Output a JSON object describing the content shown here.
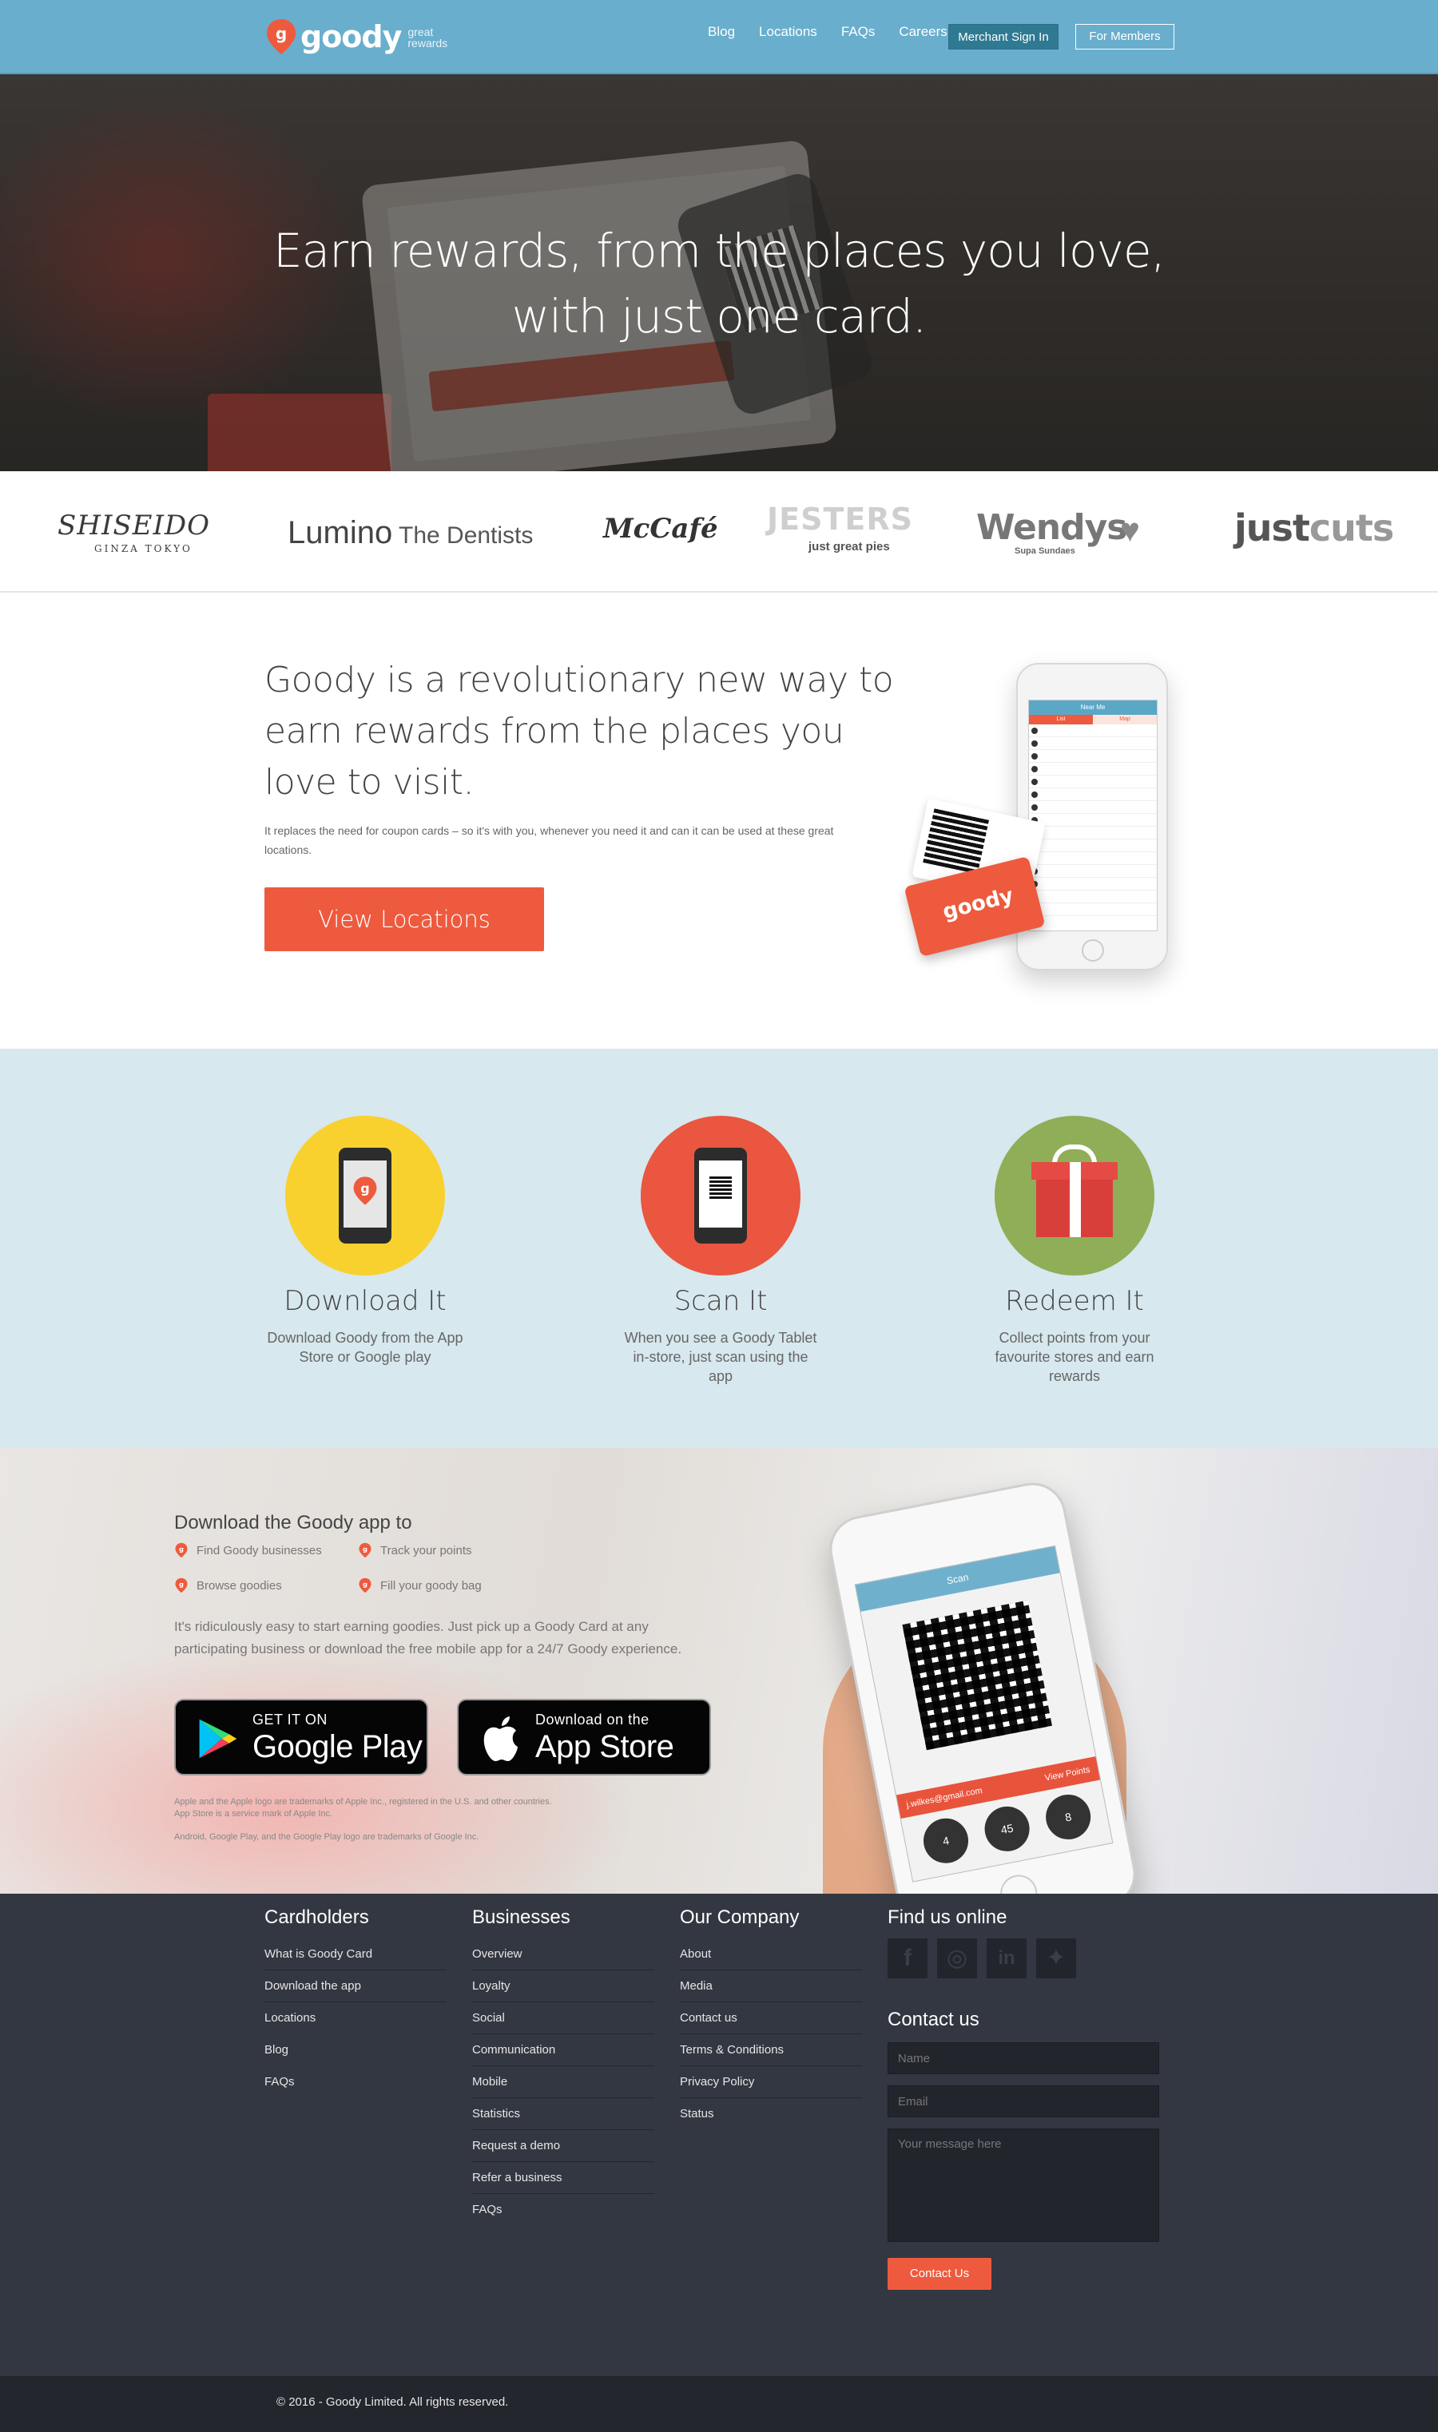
{
  "nav": {
    "logo_word": "goody",
    "logo_tagline_1": "great",
    "logo_tagline_2": "rewards",
    "links": [
      "Blog",
      "Locations",
      "FAQs",
      "Careers"
    ],
    "merchant_sign_in": "Merchant Sign In",
    "for_members": "For Members"
  },
  "hero": {
    "title_line1": "Earn rewards, from the places you love,",
    "title_line2": "with just one card."
  },
  "brands": {
    "shiseido": "SHISEIDO",
    "shiseido_sub": "GINZA TOKYO",
    "lumino": "Lumino",
    "lumino_sub": " The Dentists",
    "mccafe": "McCafé",
    "jesters": "JESTERS",
    "jesters_sub": "just great pies",
    "wendys": "Wendys",
    "wendys_sub": "Supa Sundaes",
    "justcuts_a": "just",
    "justcuts_b": "cuts"
  },
  "intro": {
    "title": "Goody is a revolutionary new way to earn rewards from the places you love to visit.",
    "text": "It replaces the need for coupon cards – so it's with you, whenever you need it and can it can be used at these great locations.",
    "button": "View Locations",
    "phone_header": "Near Me",
    "phone_tab_a": "List",
    "phone_tab_b": "Map",
    "card_word": "goody"
  },
  "steps": [
    {
      "title": "Download It",
      "desc": "Download Goody from the App Store or Google play",
      "color": "#f8d12f"
    },
    {
      "title": "Scan It",
      "desc": "When you see a Goody Tablet in-store, just scan using the app",
      "color": "#ea5640"
    },
    {
      "title": "Redeem It",
      "desc": "Collect points from your favourite stores and earn rewards",
      "color": "#8fae57"
    }
  ],
  "app": {
    "heading": "Download the Goody app to",
    "features": [
      "Find Goody businesses",
      "Track your points",
      "Browse goodies",
      "Fill your goody bag"
    ],
    "paragraph": "It's ridiculously easy to start earning goodies. Just pick up a Goody Card at any participating business or download the free mobile app for a 24/7 Goody experience.",
    "google_small": "GET IT ON",
    "google_big": "Google Play",
    "apple_small": "Download on the",
    "apple_big": "App Store",
    "legal_1": "Apple and the Apple logo are trademarks of Apple Inc., registered in the U.S. and other countries.",
    "legal_2": "App Store is a service mark of Apple Inc.",
    "legal_3": "Android, Google Play, and the Google Play logo are trademarks of Google Inc.",
    "phone_header": "Scan",
    "phone_email": "j.wilkes@gmail.com",
    "phone_link": "View Points",
    "stats": [
      "4",
      "45",
      "8"
    ]
  },
  "footer": {
    "cardholders": {
      "title": "Cardholders",
      "links": [
        "What is Goody Card",
        "Download the app",
        "Locations",
        "Blog",
        "FAQs"
      ]
    },
    "businesses": {
      "title": "Businesses",
      "links": [
        "Overview",
        "Loyalty",
        "Social",
        "Communication",
        "Mobile",
        "Statistics",
        "Request a demo",
        "Refer a business",
        "FAQs"
      ]
    },
    "company": {
      "title": "Our Company",
      "links": [
        "About",
        "Media",
        "Contact us",
        "Terms & Conditions",
        "Privacy Policy",
        "Status"
      ]
    },
    "find_us": "Find us online",
    "social_icons": [
      "facebook-icon",
      "instagram-icon",
      "linkedin-icon",
      "twitter-icon"
    ],
    "contact_title": "Contact us",
    "name_placeholder": "Name",
    "email_placeholder": "Email",
    "message_placeholder": "Your message here",
    "contact_button": "Contact Us",
    "copyright": "© 2016 - Goody Limited. All rights reserved."
  },
  "colors": {
    "nav": "#69aecd",
    "accent": "#ee5a3e",
    "steps_bg": "#d7e8ee",
    "footer": "#333741"
  }
}
